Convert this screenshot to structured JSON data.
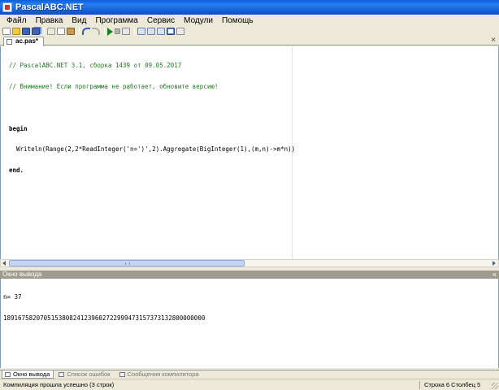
{
  "window": {
    "title": "PascalABC.NET"
  },
  "menu": [
    "Файл",
    "Правка",
    "Вид",
    "Программа",
    "Сервис",
    "Модули",
    "Помощь"
  ],
  "toolbar": {
    "icons": [
      "new-file-icon",
      "open-file-icon",
      "save-icon",
      "save-all-icon",
      "cut-icon",
      "copy-icon",
      "paste-icon",
      "undo-icon",
      "redo-icon",
      "run-icon",
      "stop-icon",
      "compile-icon",
      "debug-icon",
      "step-icon",
      "output-toggle-icon",
      "form-designer-icon"
    ]
  },
  "editor": {
    "tab_label": "ac.pas*",
    "tab_close": "×",
    "lines": [
      {
        "kind": "comment",
        "text": "// PascalABC.NET 3.1, сборка 1439 от 09.05.2017"
      },
      {
        "kind": "comment",
        "text": "// Внимание! Если программа не работает, обновите версию!"
      },
      {
        "kind": "plain",
        "text": ""
      },
      {
        "kind": "keyword",
        "text": "begin"
      },
      {
        "kind": "plain",
        "text": "  Writeln(Range(2,2*ReadInteger('n=')',2).Aggregate(BigInteger(1),(m,n)->m*n))"
      },
      {
        "kind": "keyword",
        "text": "end."
      }
    ]
  },
  "output_panel": {
    "title": "Окно вывода",
    "close": "×",
    "lines": [
      "n= 37",
      "1891675820705153808241239602722999473157373132800000000"
    ]
  },
  "bottom_tabs": [
    {
      "label": "Окно вывода",
      "active": true
    },
    {
      "label": "Список ошибок",
      "active": false
    },
    {
      "label": "Сообщения компилятора",
      "active": false
    }
  ],
  "status": {
    "message": "Компиляция прошла успешно (3 строк)",
    "position": "Строка  6  Столбец  5"
  }
}
